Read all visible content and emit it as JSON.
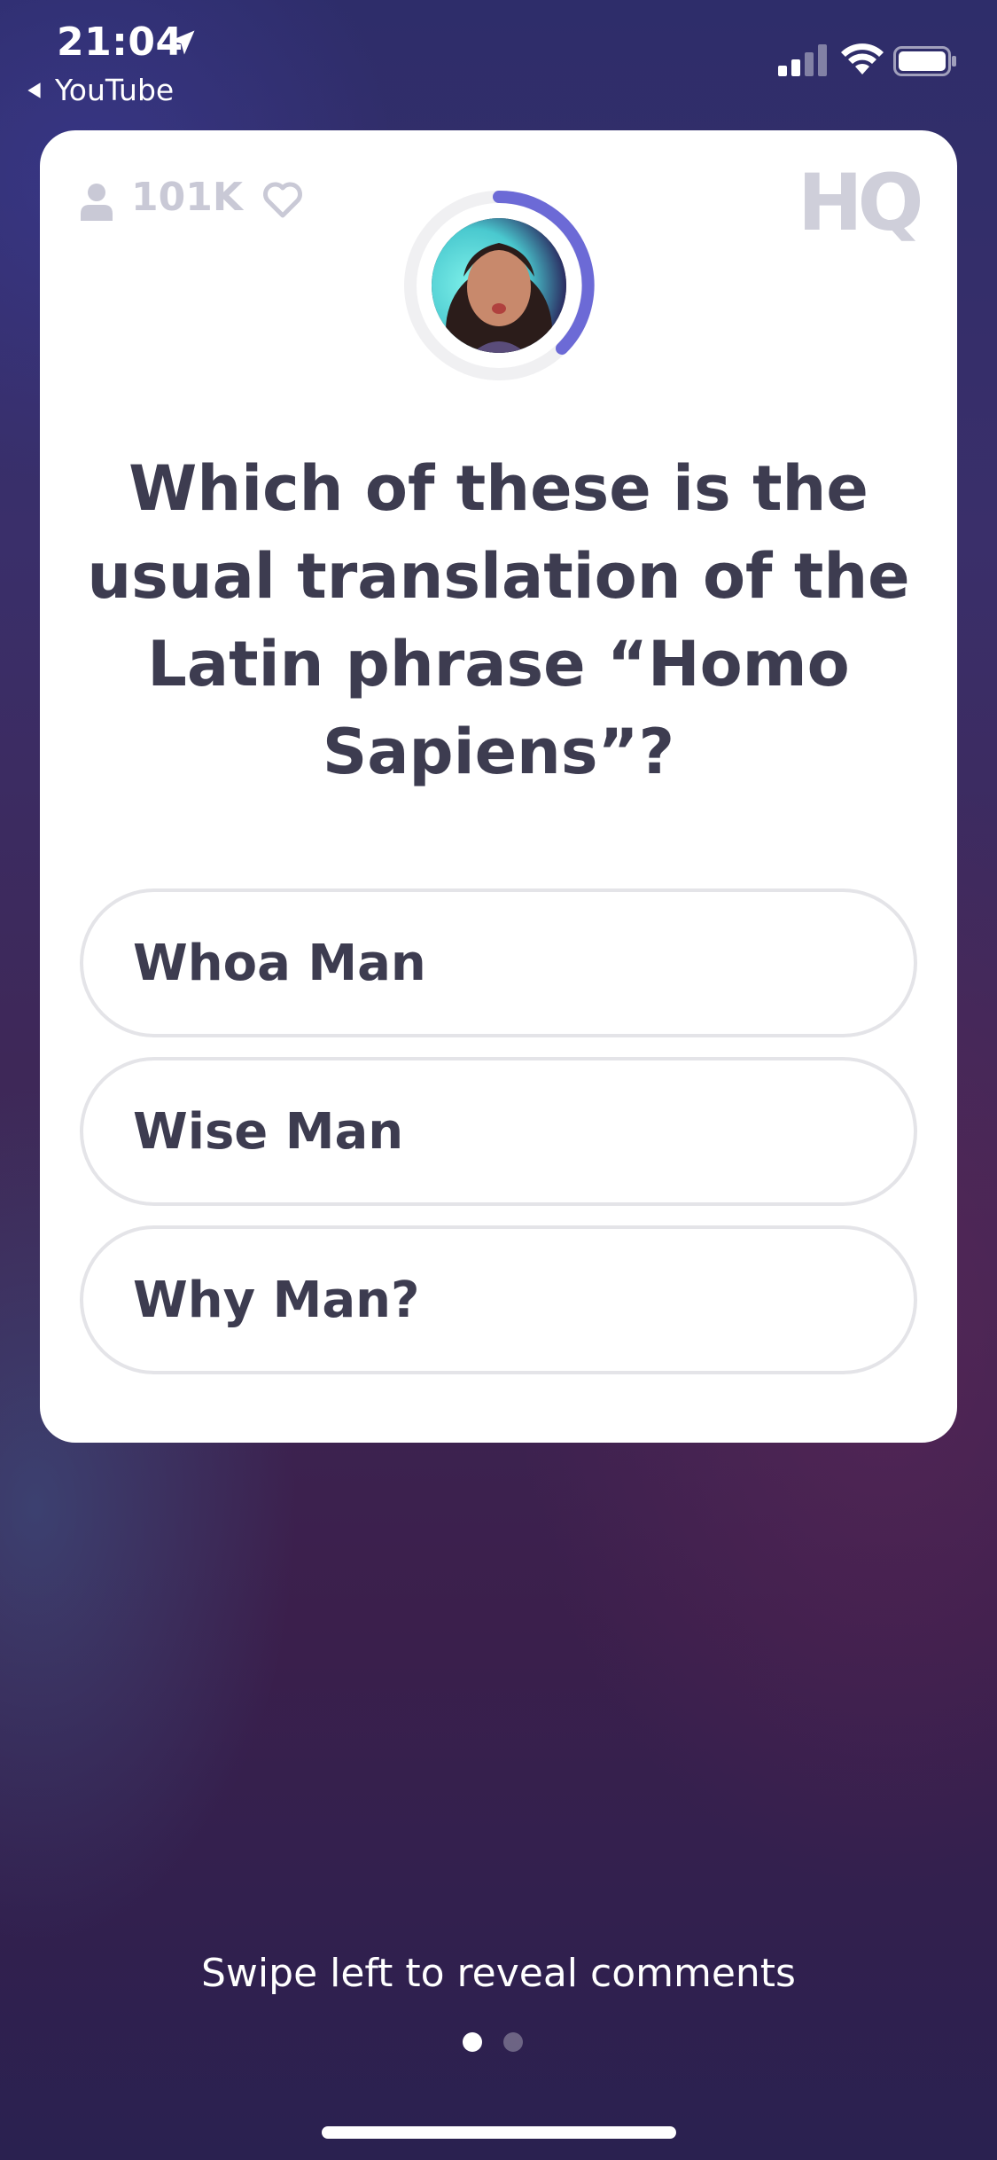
{
  "status_bar": {
    "time": "21:04",
    "back_app": "YouTube",
    "icons": [
      "location-arrow-icon",
      "cellular-signal-icon",
      "wifi-icon",
      "battery-icon"
    ]
  },
  "card": {
    "viewer_count": "101K",
    "logo": "HQ",
    "question": "Which of these is the usual translation of the Latin phrase “Homo Sapiens”?",
    "answers": [
      {
        "label": "Whoa Man"
      },
      {
        "label": "Wise Man"
      },
      {
        "label": "Why Man?"
      }
    ],
    "colors": {
      "timer_ring": "#6c6ad6",
      "text": "#3d3c50",
      "muted": "#c9c9d6"
    }
  },
  "footer": {
    "swipe_hint": "Swipe left to reveal comments",
    "page_index": 1,
    "page_count": 2
  }
}
